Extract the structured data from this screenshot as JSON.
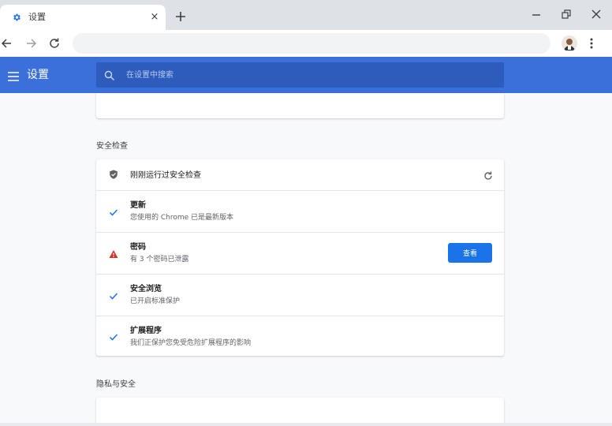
{
  "tab": {
    "title": "设置",
    "close": "×"
  },
  "settings": {
    "title": "设置",
    "search_placeholder": "在设置中搜索"
  },
  "safety": {
    "section_title": "安全检查",
    "status": "刚刚运行过安全检查",
    "items": [
      {
        "title": "更新",
        "subtitle": "您使用的 Chrome 已是最新版本",
        "status_icon": "check-icon"
      },
      {
        "title": "密码",
        "subtitle": "有 3 个密码已泄露",
        "status_icon": "warning-icon",
        "action": "查看"
      },
      {
        "title": "安全浏览",
        "subtitle": "已开启标准保护",
        "status_icon": "check-icon"
      },
      {
        "title": "扩展程序",
        "subtitle": "我们正保护您免受危险扩展程序的影响",
        "status_icon": "check-icon"
      }
    ]
  },
  "privacy": {
    "section_title": "隐私与安全"
  },
  "colors": {
    "header": "#3b6fd9",
    "accent": "#1a73e8",
    "warning": "#d93025"
  }
}
